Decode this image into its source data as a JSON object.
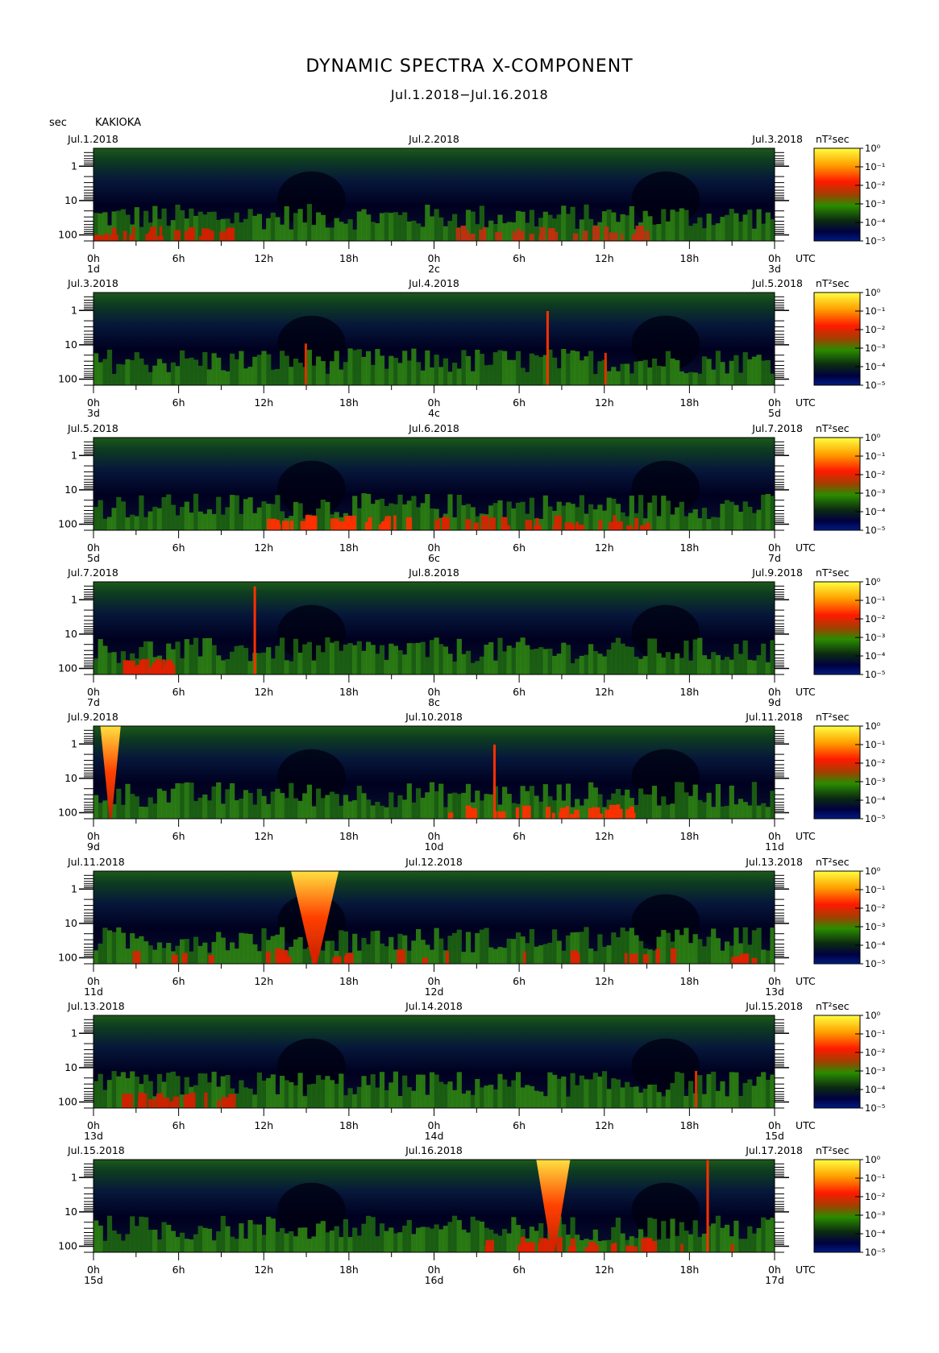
{
  "page": {
    "title": "DYNAMIC SPECTRA X-COMPONENT",
    "subtitle": "Jul.1.2018−Jul.16.2018",
    "y_unit": "sec",
    "station": "KAKIOKA"
  },
  "chart_data": {
    "type": "heatmap",
    "y_axis": {
      "label": "sec",
      "ticks": [
        "1",
        "10",
        "100"
      ],
      "scale": "log",
      "range": [
        0.3,
        150
      ]
    },
    "x_axis": {
      "tick_labels": [
        "0h",
        "6h",
        "12h",
        "18h",
        "0h",
        "6h",
        "12h",
        "18h",
        "0h"
      ],
      "unit": "UTC"
    },
    "colorbar": {
      "label": "nT²sec",
      "ticks": [
        "10⁰",
        "10⁻¹",
        "10⁻²",
        "10⁻³",
        "10⁻⁴",
        "10⁻⁵"
      ],
      "colors": [
        "#ffff40",
        "#ff9a00",
        "#ff2000",
        "#b04000",
        "#2a8c00",
        "#0b2a10",
        "#000040",
        "#001c80"
      ]
    },
    "panels": [
      {
        "left_date": "Jul.1.2018",
        "mid_date": "Jul.2.2018",
        "right_date": "Jul.3.2018",
        "day_labels": [
          "1d",
          "2c",
          "3d"
        ]
      },
      {
        "left_date": "Jul.3.2018",
        "mid_date": "Jul.4.2018",
        "right_date": "Jul.5.2018",
        "day_labels": [
          "3d",
          "4c",
          "5d"
        ]
      },
      {
        "left_date": "Jul.5.2018",
        "mid_date": "Jul.6.2018",
        "right_date": "Jul.7.2018",
        "day_labels": [
          "5d",
          "6c",
          "7d"
        ]
      },
      {
        "left_date": "Jul.7.2018",
        "mid_date": "Jul.8.2018",
        "right_date": "Jul.9.2018",
        "day_labels": [
          "7d",
          "8c",
          "9d"
        ]
      },
      {
        "left_date": "Jul.9.2018",
        "mid_date": "Jul.10.2018",
        "right_date": "Jul.11.2018",
        "day_labels": [
          "9d",
          "10d",
          "11d"
        ]
      },
      {
        "left_date": "Jul.11.2018",
        "mid_date": "Jul.12.2018",
        "right_date": "Jul.13.2018",
        "day_labels": [
          "11d",
          "12d",
          "13d"
        ]
      },
      {
        "left_date": "Jul.13.2018",
        "mid_date": "Jul.14.2018",
        "right_date": "Jul.15.2018",
        "day_labels": [
          "13d",
          "14d",
          "15d"
        ]
      },
      {
        "left_date": "Jul.15.2018",
        "mid_date": "Jul.16.2018",
        "right_date": "Jul.17.2018",
        "day_labels": [
          "15d",
          "16d",
          "17d"
        ]
      }
    ]
  }
}
